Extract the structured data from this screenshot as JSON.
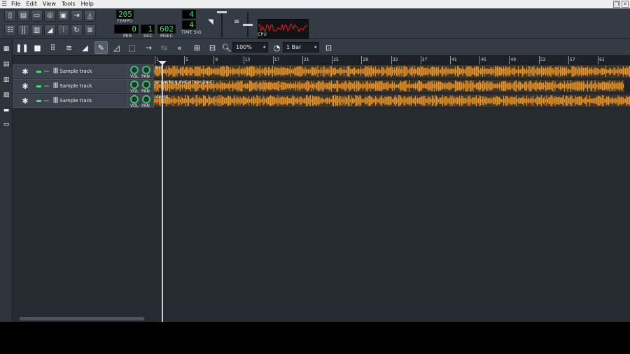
{
  "menubar": {
    "items": [
      "File",
      "Edit",
      "View",
      "Tools",
      "Help"
    ]
  },
  "window_buttons": [
    "restore-icon",
    "close-icon"
  ],
  "main_toolbar": {
    "buttons": [
      "new-project-icon",
      "new-from-template-icon",
      "open-project-icon",
      "recent-projects-icon",
      "save-icon",
      "export-icon",
      "metronome-icon",
      "song-editor-icon",
      "beat-editor-icon",
      "piano-roll-icon",
      "automation-editor-icon",
      "mixer-icon",
      "controller-rack-icon",
      "project-notes-icon"
    ],
    "tempo": {
      "value": "205",
      "label": "TEMPO"
    },
    "time": {
      "min": "0",
      "sec": "1",
      "msec": "602",
      "min_label": "MIN",
      "sec_label": "SEC",
      "msec_label": "MSEC"
    },
    "time_sig": {
      "numerator": "4",
      "denominator": "4",
      "label": "TIME SIG"
    },
    "cpu_label": "CPU"
  },
  "edit_toolbar": {
    "tools": [
      "pause-icon",
      "stop-icon",
      "add-beat-track-icon",
      "add-sample-track-icon",
      "add-automation-track-icon",
      "draw-mode-icon",
      "knife-mode-icon",
      "select-mode-icon",
      "auto-scroll-icon",
      "loop-points-icon",
      "stop-behaviour-icon",
      "insert-bar-icon",
      "remove-bar-icon"
    ],
    "zoom": "100%",
    "snap": "1 Bar"
  },
  "sidebar_icons": [
    "instrument-plugins-icon",
    "project-files-icon",
    "presets-icon",
    "home-icon",
    "root-directory-icon",
    "computer-icon"
  ],
  "ruler": {
    "labels": [
      "1",
      "5",
      "9",
      "13",
      "17",
      "21",
      "25",
      "29",
      "33",
      "37",
      "41",
      "45",
      "49",
      "53",
      "57",
      "61"
    ]
  },
  "tracks": [
    {
      "name": "Sample track",
      "vol_label": "VOL",
      "pan_label": "PAN",
      "clip_name": "Inst"
    },
    {
      "name": "Sample track",
      "vol_label": "VOL",
      "pan_label": "PAN",
      "clip_name": "screeching metal type beat"
    },
    {
      "name": "Sample track",
      "vol_label": "VOL",
      "pan_label": "PAN",
      "clip_name": "Voices"
    }
  ],
  "colors": {
    "waveform": "#e8922a",
    "lcd_green": "#3ee06a",
    "knob_green": "#36c46a",
    "cpu_line": "#e0202a"
  }
}
